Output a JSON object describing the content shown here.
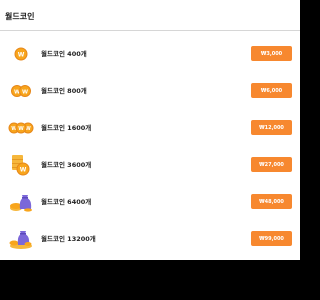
{
  "page": {
    "title": "월드코인"
  },
  "coin_symbol": "W",
  "items": [
    {
      "name": "월드코인 400개",
      "price": "₩3,000",
      "icon": "single-coin-icon"
    },
    {
      "name": "월드코인 800개",
      "price": "₩6,000",
      "icon": "two-coins-icon"
    },
    {
      "name": "월드코인 1600개",
      "price": "₩12,000",
      "icon": "three-coins-icon"
    },
    {
      "name": "월드코인 3600개",
      "price": "₩27,000",
      "icon": "coin-stack-icon"
    },
    {
      "name": "월드코인 6400개",
      "price": "₩48,000",
      "icon": "coin-pouch-icon"
    },
    {
      "name": "월드코인 13200개",
      "price": "₩99,000",
      "icon": "coin-treasure-icon"
    }
  ],
  "colors": {
    "accent": "#f7882f",
    "coin": "#f8a51c",
    "pouch": "#7b67d9",
    "background": "#000000",
    "panel": "#ffffff"
  }
}
